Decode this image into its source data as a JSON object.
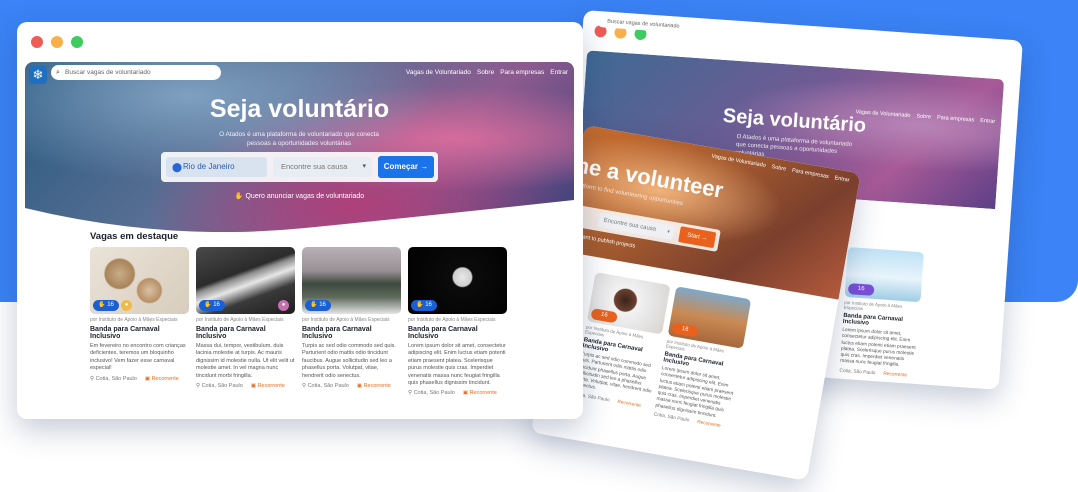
{
  "colors": {
    "accent": "#3b83f6",
    "cta": "#1a73e8",
    "recent": "#e86b1a",
    "back_cta": "#e8621e"
  },
  "main": {
    "search": {
      "placeholder": "Buscar vagas de voluntariado"
    },
    "nav": [
      "Vagas de Voluntariado",
      "Sobre",
      "Para empresas",
      "Entrar"
    ],
    "hero": {
      "title": "Seja voluntário",
      "subtitle": "O Atados é uma plataforma de voluntariado que conecta pessoas a oportunidades voluntárias",
      "city": "Rio de Janeiro",
      "cause_placeholder": "Encontre sua causa",
      "cta": "Começar",
      "announce": "Quero anunciar vagas de voluntariado"
    },
    "featured": {
      "title": "Vagas em destaque",
      "cards": [
        {
          "badge": "16",
          "org": "por Instituto de Apoio à Mães Especiais",
          "title": "Banda para Carnaval Inclusivo",
          "desc": "Em fevereiro no encontro com crianças deficientes, teremos um bloquinho inclusivo! Vem fazer esse carnaval especial!",
          "location": "Cotia, São Paulo",
          "status": "Recorrente"
        },
        {
          "badge": "16",
          "org": "por Instituto de Apoio à Mães Especiais",
          "title": "Banda para Carnaval Inclusivo",
          "desc": "Massa dui, tempor, vestibulum, duis lacinia molestie at turpis. Ac mauris dignissim id molestie nulla. Ut elit velit ut molestie amet. In vel magna nunc tincidunt morbi fringilla.",
          "location": "Cotia, São Paulo",
          "status": "Recorrente"
        },
        {
          "badge": "16",
          "org": "por Instituto de Apoio à Mães Especiais",
          "title": "Banda para Carnaval Inclusivo",
          "desc": "Turpis ac sed odio commodo sed quis. Parturient odio mattis odio tincidunt faucibus. Augue sollicitudin sed leo a phasellus porta. Volutpat, vitae, hendrerit odio senectus.",
          "location": "Cotia, São Paulo",
          "status": "Recorrente"
        },
        {
          "badge": "16",
          "org": "por Instituto de Apoio à Mães Especiais",
          "title": "Banda para Carnaval Inclusivo",
          "desc": "Lorem ipsum dolor sit amet, consectetur adipiscing elit. Enim luctus etiam potenti etiam praesent platea. Scelerisque purus molestie quis cras. Imperdiet venenatis massa nunc feugiat fringilla quis phasellus dignissim tincidunt.",
          "location": "Cotia, São Paulo",
          "status": "Recorrente"
        }
      ]
    }
  },
  "back": {
    "search_placeholder": "Buscar vagas de voluntariado",
    "nav": [
      "Vagas de Voluntariado",
      "Sobre",
      "Para empresas",
      "Entrar"
    ],
    "title": "Seja voluntário",
    "subtitle": "O Atados é uma plataforma de voluntariado que conecta pessoas a oportunidades voluntárias",
    "card": {
      "badge": "16",
      "org": "por Instituto de Apoio à Mães Especiais",
      "title": "Banda para Carnaval Inclusivo",
      "desc": "Lorem ipsum dolor sit amet, consectetur adipiscing elit. Enim luctus etiam potenti etiam praesent platea. Scelerisque purus molestie quis cras. Imperdiet venenatis massa nunc feugiat fringilla.",
      "location": "Cotia, São Paulo",
      "status": "Recorrente"
    }
  },
  "middle": {
    "nav": [
      "Vagas de Voluntariado",
      "Sobre",
      "Para empresas",
      "Entrar"
    ],
    "title": "me a volunteer",
    "subtitle": "platform to find volunteering opportunities",
    "cause_placeholder": "Encontre sua causa",
    "cta": "Start",
    "publish": "I want to publish projects",
    "cards": [
      {
        "badge": "16",
        "org": "por Instituto de Apoio à Mães Especiais",
        "title": "Banda para Carnaval Inclusivo",
        "desc": "Turpis ac sed odio commodo sed quis. Parturient odio mattis odio tincidunt phasellus porta. Augue sollicitudin sed leo a phasellus porta. Volutpat, vitae, hendrerit odio senectus.",
        "location": "Cotia, São Paulo",
        "status": "Recorrente"
      },
      {
        "badge": "16",
        "org": "por Instituto de Apoio à Mães Especiais",
        "title": "Banda para Carnaval Inclusivo",
        "desc": "Lorem ipsum dolor sit amet, consectetur adipiscing elit. Enim luctus etiam potenti etiam praesent platea. Scelerisque purus molestie quis cras. Imperdiet venenatis massa nunc feugiat fringilla quis phasellus dignissim tincidunt.",
        "location": "Cotia, São Paulo",
        "status": "Recorrente"
      }
    ]
  }
}
